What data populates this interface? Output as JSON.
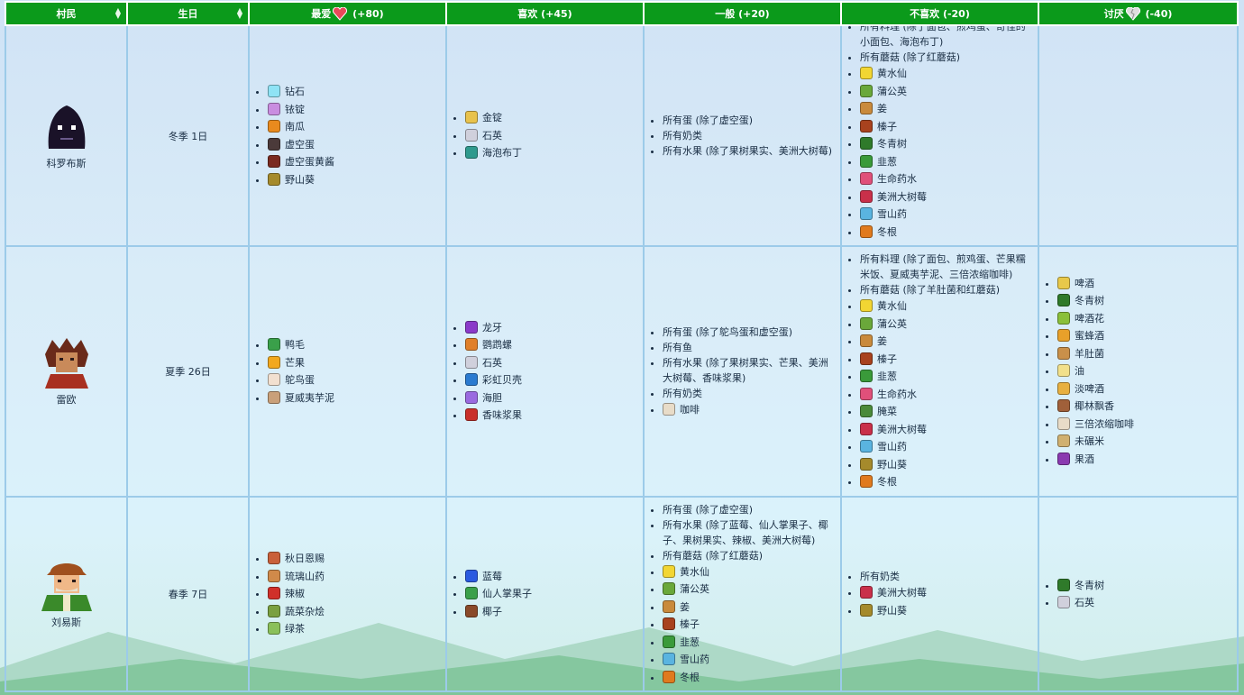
{
  "headers": {
    "villager": "村民",
    "birthday": "生日",
    "love": "最爱",
    "love_pts": "(+80)",
    "like": "喜欢 (+45)",
    "neutral": "一般 (+20)",
    "dislike": "不喜欢 (-20)",
    "hate": "讨厌",
    "hate_pts": "(-40)"
  },
  "colors": {
    "header_bg": "#0b9a1b",
    "border": "#9ccbe9",
    "text": "#1a2e44"
  },
  "rows": [
    {
      "name": "科罗布斯",
      "birthday": "冬季 1日",
      "love": [
        {
          "label": "钻石",
          "icon": "diamond-icon",
          "color": "#8fe3f5"
        },
        {
          "label": "铱锭",
          "icon": "iridium-bar-icon",
          "color": "#c98de0"
        },
        {
          "label": "南瓜",
          "icon": "pumpkin-icon",
          "color": "#e98a1e"
        },
        {
          "label": "虚空蛋",
          "icon": "void-egg-icon",
          "color": "#4b3a3a"
        },
        {
          "label": "虚空蛋黄酱",
          "icon": "void-mayo-icon",
          "color": "#7a2a20"
        },
        {
          "label": "野山葵",
          "icon": "wild-horseradish-icon",
          "color": "#a58a2c"
        }
      ],
      "like": [
        {
          "label": "金锭",
          "icon": "gold-bar-icon",
          "color": "#e8c24c"
        },
        {
          "label": "石英",
          "icon": "quartz-icon",
          "color": "#d0d0dc"
        },
        {
          "label": "海泡布丁",
          "icon": "sea-foam-pudding-icon",
          "color": "#2f9a8e"
        }
      ],
      "neutral": [
        {
          "label": "所有蛋 (除了虚空蛋)"
        },
        {
          "label": "所有奶类"
        },
        {
          "label": "所有水果 (除了果树果实、美洲大树莓)"
        }
      ],
      "dislike": [
        {
          "label": "所有料理 (除了面包、煎鸡蛋、奇怪的小面包、海泡布丁)"
        },
        {
          "label": "所有蘑菇 (除了红蘑菇)"
        },
        {
          "label": "黄水仙",
          "icon": "daffodil-icon",
          "color": "#f2d633"
        },
        {
          "label": "蒲公英",
          "icon": "dandelion-icon",
          "color": "#6aa83a"
        },
        {
          "label": "姜",
          "icon": "ginger-icon",
          "color": "#c98a3c"
        },
        {
          "label": "榛子",
          "icon": "hazelnut-icon",
          "color": "#a8421e"
        },
        {
          "label": "冬青树",
          "icon": "holly-icon",
          "color": "#2f7a2a"
        },
        {
          "label": "韭葱",
          "icon": "leek-icon",
          "color": "#3a9a3a"
        },
        {
          "label": "生命药水",
          "icon": "life-elixir-icon",
          "color": "#e0507a"
        },
        {
          "label": "美洲大树莓",
          "icon": "salmonberry-icon",
          "color": "#c9304a"
        },
        {
          "label": "雪山药",
          "icon": "snow-yam-icon",
          "color": "#5ab4e0"
        },
        {
          "label": "冬根",
          "icon": "winter-root-icon",
          "color": "#e07a1e"
        }
      ],
      "hate": []
    },
    {
      "name": "雷欧",
      "birthday": "夏季 26日",
      "love": [
        {
          "label": "鸭毛",
          "icon": "duck-feather-icon",
          "color": "#3aa04a"
        },
        {
          "label": "芒果",
          "icon": "mango-icon",
          "color": "#f2a81e"
        },
        {
          "label": "鸵鸟蛋",
          "icon": "ostrich-egg-icon",
          "color": "#f2e0d0"
        },
        {
          "label": "夏威夷芋泥",
          "icon": "poi-icon",
          "color": "#c9a07a"
        }
      ],
      "like": [
        {
          "label": "龙牙",
          "icon": "dragon-tooth-icon",
          "color": "#8a3ac9"
        },
        {
          "label": "鹦鹉螺",
          "icon": "nautilus-icon",
          "color": "#e0802a"
        },
        {
          "label": "石英",
          "icon": "quartz-icon",
          "color": "#d0d0dc"
        },
        {
          "label": "彩虹贝壳",
          "icon": "rainbow-shell-icon",
          "color": "#2a7ad0"
        },
        {
          "label": "海胆",
          "icon": "sea-urchin-icon",
          "color": "#9a6ae0"
        },
        {
          "label": "香味浆果",
          "icon": "spice-berry-icon",
          "color": "#c9302a"
        }
      ],
      "neutral": [
        {
          "label": "所有蛋 (除了鸵鸟蛋和虚空蛋)"
        },
        {
          "label": "所有鱼"
        },
        {
          "label": "所有水果 (除了果树果实、芒果、美洲大树莓、香味浆果)"
        },
        {
          "label": "所有奶类"
        },
        {
          "label": "咖啡",
          "icon": "coffee-icon",
          "color": "#e8dcc8"
        }
      ],
      "dislike": [
        {
          "label": "所有料理 (除了面包、煎鸡蛋、芒果糯米饭、夏威夷芋泥、三倍浓缩咖啡)"
        },
        {
          "label": "所有蘑菇 (除了羊肚菌和红蘑菇)"
        },
        {
          "label": "黄水仙",
          "icon": "daffodil-icon",
          "color": "#f2d633"
        },
        {
          "label": "蒲公英",
          "icon": "dandelion-icon",
          "color": "#6aa83a"
        },
        {
          "label": "姜",
          "icon": "ginger-icon",
          "color": "#c98a3c"
        },
        {
          "label": "榛子",
          "icon": "hazelnut-icon",
          "color": "#a8421e"
        },
        {
          "label": "韭葱",
          "icon": "leek-icon",
          "color": "#3a9a3a"
        },
        {
          "label": "生命药水",
          "icon": "life-elixir-icon",
          "color": "#e0507a"
        },
        {
          "label": "腌菜",
          "icon": "pickles-icon",
          "color": "#4a8a3a"
        },
        {
          "label": "美洲大树莓",
          "icon": "salmonberry-icon",
          "color": "#c9304a"
        },
        {
          "label": "雪山药",
          "icon": "snow-yam-icon",
          "color": "#5ab4e0"
        },
        {
          "label": "野山葵",
          "icon": "wild-horseradish-icon",
          "color": "#a58a2c"
        },
        {
          "label": "冬根",
          "icon": "winter-root-icon",
          "color": "#e07a1e"
        }
      ],
      "hate": [
        {
          "label": "啤酒",
          "icon": "beer-icon",
          "color": "#e8c84a"
        },
        {
          "label": "冬青树",
          "icon": "holly-icon",
          "color": "#2f7a2a"
        },
        {
          "label": "啤酒花",
          "icon": "hops-icon",
          "color": "#8ac03a"
        },
        {
          "label": "蜜蜂酒",
          "icon": "mead-icon",
          "color": "#e8a02a"
        },
        {
          "label": "羊肚菌",
          "icon": "morel-icon",
          "color": "#c9904a"
        },
        {
          "label": "油",
          "icon": "oil-icon",
          "color": "#f2e08a"
        },
        {
          "label": "淡啤酒",
          "icon": "pale-ale-icon",
          "color": "#e8b040"
        },
        {
          "label": "椰林飘香",
          "icon": "pina-colada-icon",
          "color": "#a0603a"
        },
        {
          "label": "三倍浓缩咖啡",
          "icon": "triple-espresso-icon",
          "color": "#e8dcc8"
        },
        {
          "label": "未碾米",
          "icon": "unmilled-rice-icon",
          "color": "#d0b070"
        },
        {
          "label": "果酒",
          "icon": "wine-icon",
          "color": "#8a3ab0"
        }
      ]
    },
    {
      "name": "刘易斯",
      "birthday": "春季 7日",
      "love": [
        {
          "label": "秋日恩赐",
          "icon": "autumns-bounty-icon",
          "color": "#c9603a"
        },
        {
          "label": "琉璃山药",
          "icon": "glazed-yams-icon",
          "color": "#d08a4a"
        },
        {
          "label": "辣椒",
          "icon": "hot-pepper-icon",
          "color": "#d0302a"
        },
        {
          "label": "蔬菜杂烩",
          "icon": "vegetable-medley-icon",
          "color": "#7aa040"
        },
        {
          "label": "绿茶",
          "icon": "green-tea-icon",
          "color": "#8ac05a"
        }
      ],
      "like": [
        {
          "label": "蓝莓",
          "icon": "blueberry-icon",
          "color": "#2a5ae0"
        },
        {
          "label": "仙人掌果子",
          "icon": "cactus-fruit-icon",
          "color": "#3aa04a"
        },
        {
          "label": "椰子",
          "icon": "coconut-icon",
          "color": "#8a4a2a"
        }
      ],
      "neutral": [
        {
          "label": "所有蛋 (除了虚空蛋)"
        },
        {
          "label": "所有水果 (除了蓝莓、仙人掌果子、椰子、果树果实、辣椒、美洲大树莓)"
        },
        {
          "label": "所有蘑菇 (除了红蘑菇)"
        },
        {
          "label": "黄水仙",
          "icon": "daffodil-icon",
          "color": "#f2d633"
        },
        {
          "label": "蒲公英",
          "icon": "dandelion-icon",
          "color": "#6aa83a"
        },
        {
          "label": "姜",
          "icon": "ginger-icon",
          "color": "#c98a3c"
        },
        {
          "label": "榛子",
          "icon": "hazelnut-icon",
          "color": "#a8421e"
        },
        {
          "label": "韭葱",
          "icon": "leek-icon",
          "color": "#3a9a3a"
        },
        {
          "label": "雪山药",
          "icon": "snow-yam-icon",
          "color": "#5ab4e0"
        },
        {
          "label": "冬根",
          "icon": "winter-root-icon",
          "color": "#e07a1e"
        }
      ],
      "dislike": [
        {
          "label": "所有奶类"
        },
        {
          "label": "美洲大树莓",
          "icon": "salmonberry-icon",
          "color": "#c9304a"
        },
        {
          "label": "野山葵",
          "icon": "wild-horseradish-icon",
          "color": "#a58a2c"
        }
      ],
      "hate": [
        {
          "label": "冬青树",
          "icon": "holly-icon",
          "color": "#2f7a2a"
        },
        {
          "label": "石英",
          "icon": "quartz-icon",
          "color": "#d0d0dc"
        }
      ]
    }
  ]
}
